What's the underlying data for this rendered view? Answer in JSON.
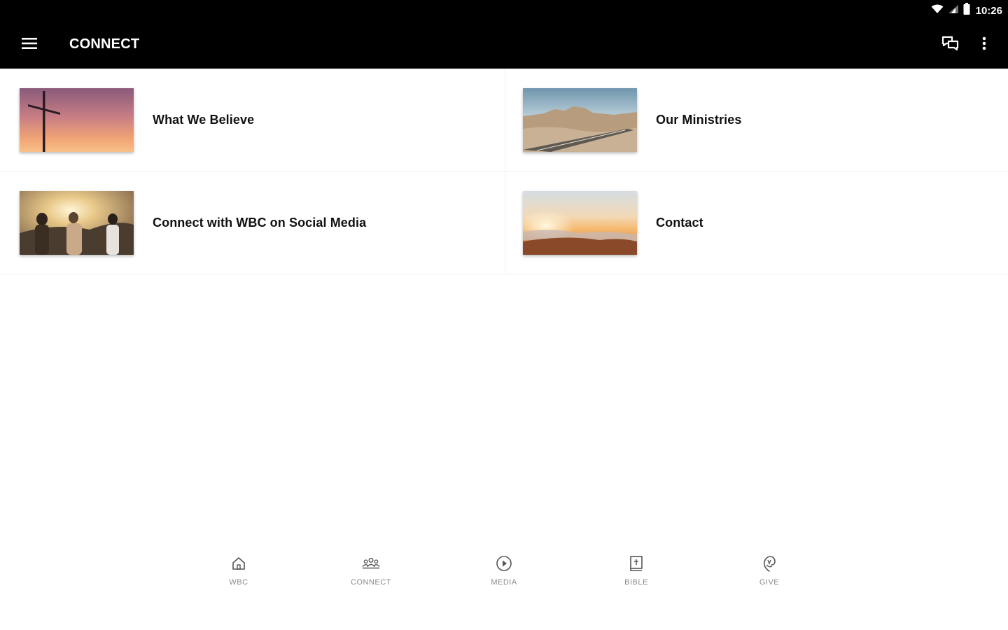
{
  "status_bar": {
    "time": "10:26",
    "icons": [
      "wifi-icon",
      "cell-signal-icon",
      "battery-icon"
    ]
  },
  "app_bar": {
    "title": "CONNECT",
    "icons": [
      "hamburger-menu-icon",
      "chat-bubbles-icon",
      "more-vert-icon"
    ]
  },
  "tiles": [
    {
      "label": "What We Believe",
      "image": "cross-at-sunset"
    },
    {
      "label": "Our Ministries",
      "image": "desert-road"
    },
    {
      "label": "Connect with WBC on Social Media",
      "image": "people-at-sunset"
    },
    {
      "label": "Contact",
      "image": "sunrise-above-clouds"
    }
  ],
  "bottom_nav": {
    "items": [
      {
        "label": "WBC",
        "icon": "home-icon"
      },
      {
        "label": "CONNECT",
        "icon": "group-icon"
      },
      {
        "label": "MEDIA",
        "icon": "play-circle-icon"
      },
      {
        "label": "BIBLE",
        "icon": "bible-icon"
      },
      {
        "label": "GIVE",
        "icon": "give-hand-icon"
      }
    ]
  },
  "colors": {
    "app_bar": "#000000",
    "background": "#ffffff",
    "nav_label": "#8a8a8a"
  }
}
